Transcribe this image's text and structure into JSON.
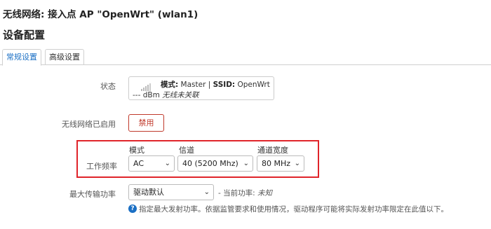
{
  "page": {
    "heading": "无线网络: 接入点 AP \"OpenWrt\" (wlan1)",
    "section_title": "设备配置"
  },
  "tabs": [
    {
      "label": "常规设置",
      "active": true
    },
    {
      "label": "高级设置",
      "active": false
    }
  ],
  "status": {
    "label": "状态",
    "icon": "signal-bars-icon",
    "mode_label": "模式:",
    "mode_value": "Master",
    "separator": "|",
    "ssid_label": "SSID:",
    "ssid_value": "OpenWrt",
    "dbm": "--- dBm",
    "assoc_state": "无线未关联"
  },
  "wireless_enabled": {
    "label": "无线网络已启用",
    "button_label": "禁用",
    "button_color": "#c0392b"
  },
  "frequency": {
    "label": "工作频率",
    "mode": {
      "label": "模式",
      "value": "AC"
    },
    "channel": {
      "label": "信道",
      "value": "40 (5200 Mhz)"
    },
    "width": {
      "label": "通道宽度",
      "value": "80 MHz"
    },
    "highlight_color": "#e0242a"
  },
  "tx_power": {
    "label": "最大传输功率",
    "value": "驱动默认",
    "current_prefix": "- 当前功率:",
    "current_value": "未知",
    "help_text": "指定最大发射功率。依据监管要求和使用情况，驱动程序可能将实际发射功率限定在此值以下。"
  },
  "colors": {
    "accent": "#1a6fc4"
  }
}
